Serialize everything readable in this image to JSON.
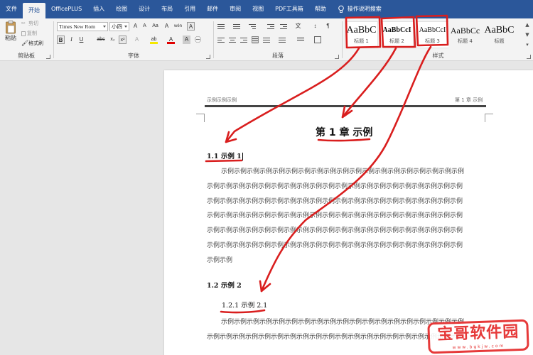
{
  "menu_tabs": [
    "文件",
    "开始",
    "OfficePLUS",
    "插入",
    "绘图",
    "设计",
    "布局",
    "引用",
    "邮件",
    "审阅",
    "视图",
    "PDF工具箱",
    "帮助"
  ],
  "active_tab": "开始",
  "tell_me": "操作说明搜索",
  "clipboard": {
    "paste": "粘贴",
    "cut": "剪切",
    "copy": "复制",
    "format_painter": "格式刷",
    "label": "剪贴板"
  },
  "font": {
    "name": "Times New Rom",
    "size": "小四",
    "bold": "B",
    "italic": "I",
    "underline": "U",
    "strike": "abc",
    "subscript": "x₂",
    "superscript": "x²",
    "grow": "A",
    "shrink": "A",
    "case": "Aa",
    "clear": "A",
    "phonetic": "wén",
    "char_border": "A",
    "highlight": "ab",
    "font_color": "A",
    "char_shading": "A",
    "enclose": "㊀",
    "label": "字体"
  },
  "paragraph": {
    "label": "段落",
    "sort": "↕",
    "marks": "¶"
  },
  "styles": {
    "label": "样式",
    "items": [
      {
        "sample": "AaBbC",
        "name": "标题 1"
      },
      {
        "sample": "AaBbCcI",
        "name": "标题 2"
      },
      {
        "sample": "AaBbCcI",
        "name": "标题 3"
      },
      {
        "sample": "AaBbCc",
        "name": "标题 4"
      },
      {
        "sample": "AaBbC",
        "name": "标题"
      }
    ]
  },
  "document": {
    "header_left": "示例示例示例",
    "header_right": "第 1 章 示例",
    "chapter_title": "第 1 章 示例",
    "sec_1_1": "1.1 示例 1",
    "para1_lines": [
      "示例示例示例示例示例示例示例示例示例示例示例示例示例示例示例示例示例示例示例",
      "示例示例示例示例示例示例示例示例示例示例示例示例示例示例示例示例示例示例示例示例",
      "示例示例示例示例示例示例示例示例示例示例示例示例示例示例示例示例示例示例示例示例",
      "示例示例示例示例示例示例示例示例示例示例示例示例示例示例示例示例示例示例示例示例",
      "示例示例示例示例示例示例示例示例示例示例示例示例示例示例示例示例示例示例示例示例",
      "示例示例示例示例示例示例示例示例示例示例示例示例示例示例示例示例示例示例示例示例",
      "示例示例"
    ],
    "sec_1_2": "1.2 示例 2",
    "sec_1_2_1": "1.2.1 示例 2.1",
    "para2_lines": [
      "示例示例示例示例示例示例示例示例示例示例示例示例示例示例示例示例示例示例示例",
      "示例示例示例示例示例示例示例示例示例示例示例示例示例示例示例示例示例示例示例示例"
    ]
  },
  "watermark": {
    "text": "宝哥软件园",
    "sub": "www.bgkjw.com"
  },
  "colors": {
    "ribbon_blue": "#2b579a",
    "annotation_red": "#d91e1e",
    "watermark_red": "#e63a3a"
  }
}
